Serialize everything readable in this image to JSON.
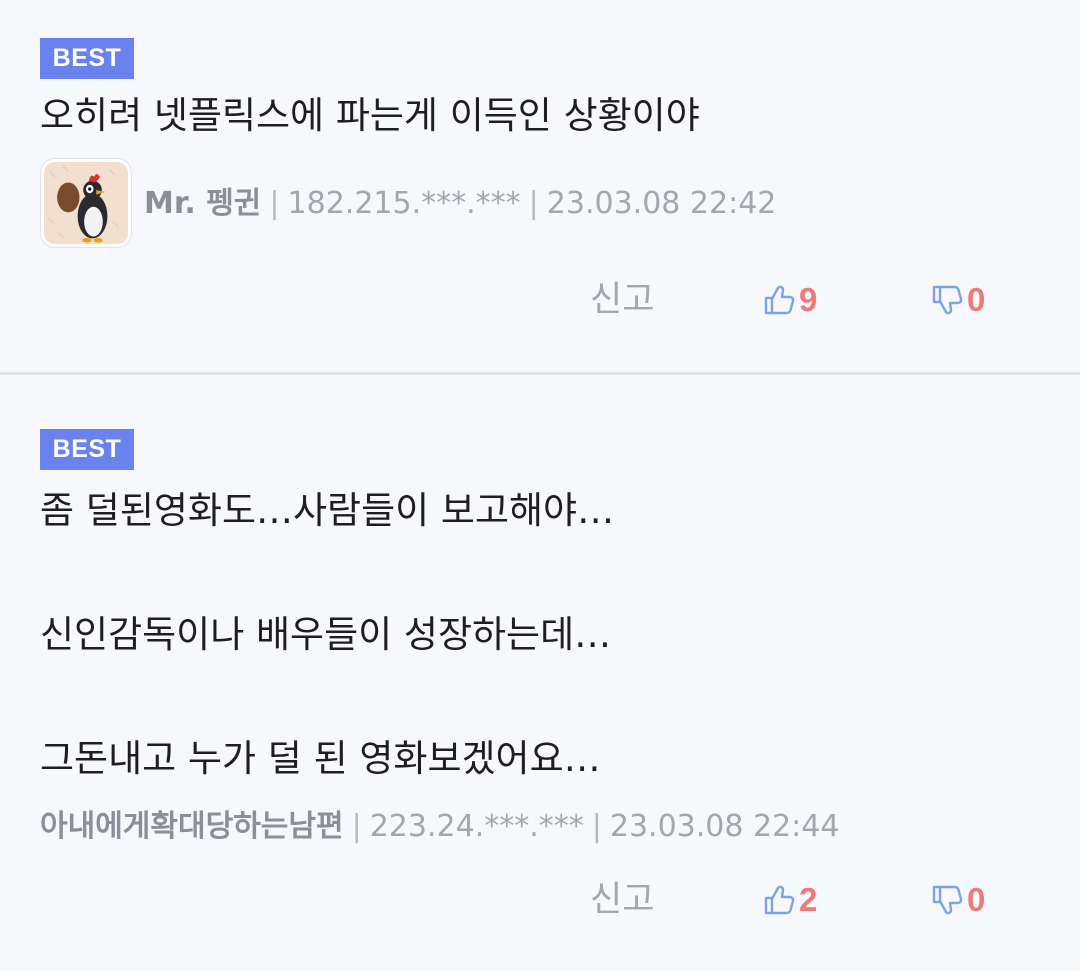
{
  "comments": [
    {
      "badge": "BEST",
      "lines": [
        "오히려 넷플릭스에 파는게 이득인 상황이야"
      ],
      "author": "Mr. 펭귄",
      "ip": "182.215.***.***",
      "date": "23.03.08 22:42",
      "report_label": "신고",
      "likes": "9",
      "dislikes": "0",
      "avatar_icon": "penguin-with-drumstick-icon"
    },
    {
      "badge": "BEST",
      "lines": [
        "좀 덜된영화도…사람들이 보고해야…",
        "신인감독이나 배우들이 성장하는데…",
        "그돈내고 누가 덜 된 영화보겠어요…"
      ],
      "author": "아내에게확대당하는남편",
      "ip": "223.24.***.***",
      "date": "23.03.08 22:44",
      "report_label": "신고",
      "likes": "2",
      "dislikes": "0"
    }
  ],
  "separator": "|",
  "colors": {
    "badge_bg": "#6a82ee",
    "like_icon": "#7da3e6",
    "count": "#ec7a78",
    "meta": "#a3a6ad",
    "background": "#f6f8fc"
  }
}
